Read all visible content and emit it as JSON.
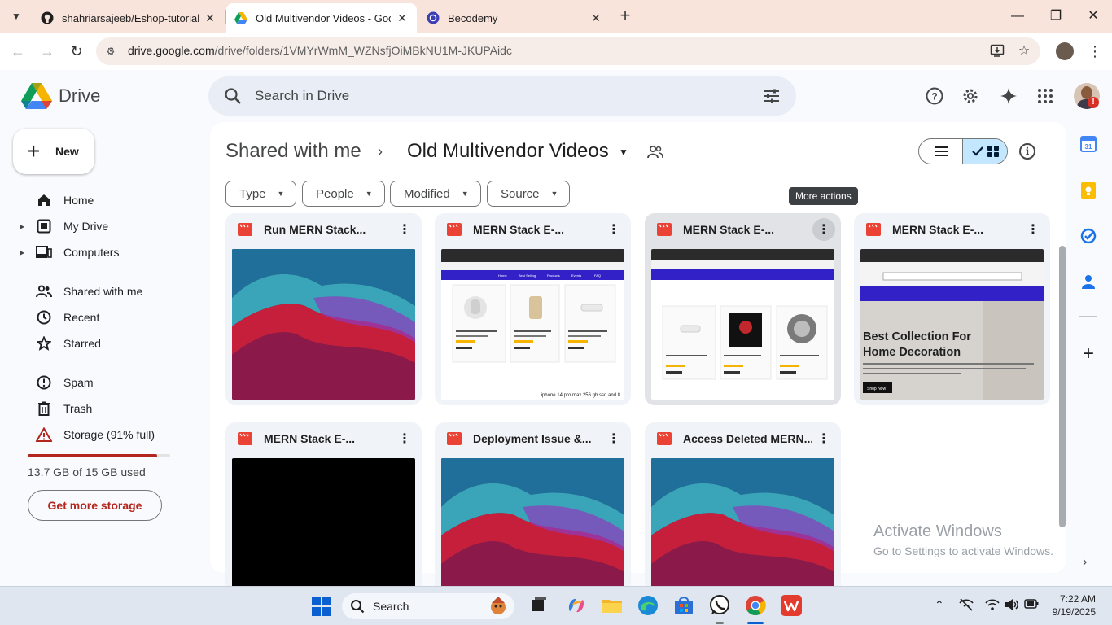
{
  "browser": {
    "tabs": [
      {
        "title": "shahriarsajeeb/Eshop-tutorial",
        "icon": "github-icon",
        "active": false
      },
      {
        "title": "Old Multivendor Videos - Goog",
        "icon": "google-drive-icon",
        "active": true
      },
      {
        "title": "Becodemy",
        "icon": "becodemy-icon",
        "active": false
      }
    ],
    "url_host": "drive.google.com",
    "url_path": "/drive/folders/1VMYrWmM_WZNsfjOiMBkNU1M-JKUPAidc"
  },
  "drive": {
    "logo_text": "Drive",
    "search_placeholder": "Search in Drive",
    "new_button": "New",
    "nav": [
      {
        "label": "Home",
        "icon": "home-icon",
        "expandable": false
      },
      {
        "label": "My Drive",
        "icon": "my-drive-icon",
        "expandable": true
      },
      {
        "label": "Computers",
        "icon": "computers-icon",
        "expandable": true
      },
      {
        "label": "Shared with me",
        "icon": "shared-with-me-icon",
        "expandable": false
      },
      {
        "label": "Recent",
        "icon": "recent-icon",
        "expandable": false
      },
      {
        "label": "Starred",
        "icon": "star-icon",
        "expandable": false
      },
      {
        "label": "Spam",
        "icon": "spam-icon",
        "expandable": false
      },
      {
        "label": "Trash",
        "icon": "trash-icon",
        "expandable": false
      },
      {
        "label": "Storage (91% full)",
        "icon": "storage-warning-icon",
        "expandable": false
      }
    ],
    "storage": {
      "used_fraction": 0.91,
      "text": "13.7 GB of 15 GB used",
      "button": "Get more storage"
    },
    "breadcrumb": {
      "parent": "Shared with me",
      "current": "Old Multivendor Videos"
    },
    "filters": [
      "Type",
      "People",
      "Modified",
      "Source"
    ],
    "tooltip": "More actions",
    "files": [
      {
        "title": "Run MERN Stack...",
        "thumb": "wallpaper"
      },
      {
        "title": "MERN Stack E-...",
        "thumb": "shop-products"
      },
      {
        "title": "MERN Stack E-...",
        "thumb": "shop-products-2"
      },
      {
        "title": "MERN Stack E-...",
        "thumb": "shop-hero"
      },
      {
        "title": "MERN Stack E-...",
        "thumb": "black"
      },
      {
        "title": "Deployment Issue &...",
        "thumb": "wallpaper"
      },
      {
        "title": "Access Deleted MERN...",
        "thumb": "wallpaper"
      }
    ],
    "thumb_texts": {
      "nav_links": [
        "Home",
        "Best Selling",
        "Products",
        "Events",
        "FAQ"
      ],
      "caption": "iphone 14 pro max 256 gb ssd and 8",
      "hero_title_1": "Best Collection For",
      "hero_title_2": "Home Decoration",
      "hero_button": "Shop Now"
    }
  },
  "watermark": {
    "line1": "Activate Windows",
    "line2": "Go to Settings to activate Windows."
  },
  "taskbar": {
    "search_label": "Search",
    "time": "7:22 AM",
    "date": "9/19/2025"
  },
  "colors": {
    "drive_blue": "#4285f4",
    "drive_green": "#0f9d58",
    "drive_yellow": "#f4b400",
    "drive_red": "#db4437",
    "storage_warning": "#b3261e",
    "selected_view": "#c2e7ff"
  }
}
